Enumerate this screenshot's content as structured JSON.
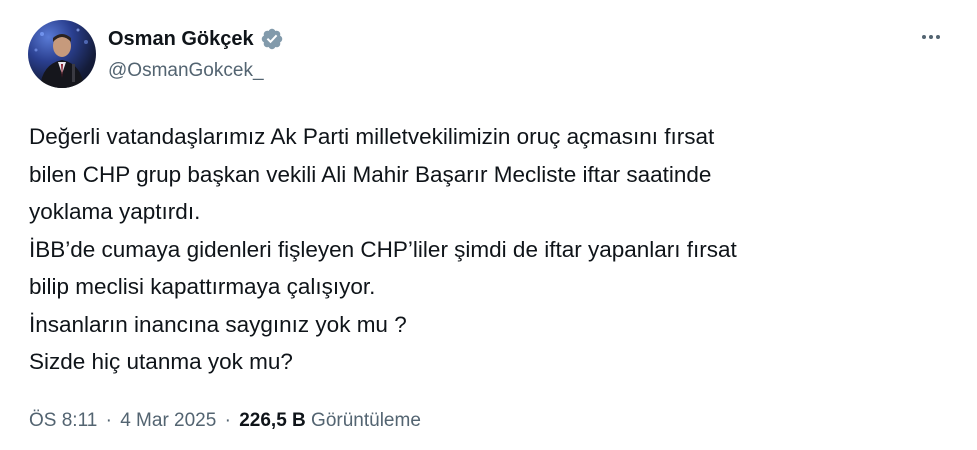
{
  "author": {
    "display_name": "Osman Gökçek",
    "handle": "@OsmanGokcek_",
    "verified": true,
    "verified_color": "#829aab"
  },
  "tweet": {
    "lines": [
      "Değerli vatandaşlarımız Ak Parti milletvekilimizin oruç açmasını fırsat",
      "bilen CHP grup başkan vekili Ali Mahir Başarır Mecliste iftar saatinde",
      "yoklama yaptırdı.",
      "İBB’de cumaya gidenleri fişleyen CHP’liler şimdi de iftar yapanları fırsat",
      "bilip meclisi kapattırmaya çalışıyor.",
      "İnsanların inancına saygınız yok mu ?",
      "Sizde hiç utanma yok mu?"
    ]
  },
  "meta": {
    "time": "ÖS 8:11",
    "separator": "·",
    "date": "4 Mar 2025",
    "views_count": "226,5 B",
    "views_label": "Görüntüleme"
  },
  "icons": {
    "more": "more-horizontal-icon",
    "verified": "verified-badge-icon"
  }
}
